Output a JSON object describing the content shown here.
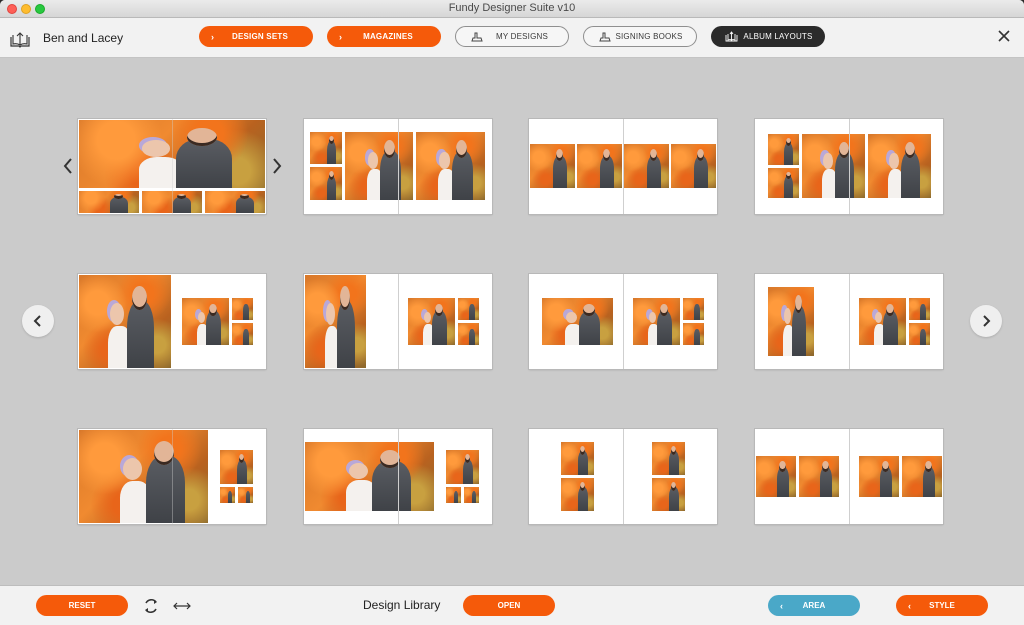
{
  "window": {
    "title": "Fundy Designer Suite v10"
  },
  "toolbar": {
    "project_name": "Ben and Lacey",
    "logo_icon": "open-book-icon",
    "nav": [
      {
        "label": "DESIGN SETS",
        "style": "orange",
        "icon": "chevron-right-icon"
      },
      {
        "label": "MAGAZINES",
        "style": "orange",
        "icon": "chevron-right-icon"
      },
      {
        "label": "MY DESIGNS",
        "style": "outline",
        "icon": "pen-hand-icon"
      },
      {
        "label": "SIGNING BOOKS",
        "style": "outline",
        "icon": "pen-hand-icon"
      },
      {
        "label": "ALBUM LAYOUTS",
        "style": "dark",
        "icon": "album-icon",
        "active": true
      }
    ],
    "close_icon": "close-icon"
  },
  "colors": {
    "accent_orange": "#f55a0a",
    "area_blue": "#4aa8c8",
    "active_dark": "#2b2b2b",
    "canvas_gray": "#cbcbcb"
  },
  "content": {
    "prev_set_icon": "chevron-left-icon",
    "next_set_icon": "chevron-right-icon",
    "page_prev_icon": "chevron-left-circle-icon",
    "page_next_icon": "chevron-right-circle-icon",
    "layouts": [
      {
        "row": 1,
        "col": 1,
        "name": "full-bleed-panorama-with-three-strip",
        "selected": true
      },
      {
        "row": 1,
        "col": 2,
        "name": "two-stacked-plus-two-large"
      },
      {
        "row": 1,
        "col": 3,
        "name": "four-across-center-band"
      },
      {
        "row": 1,
        "col": 4,
        "name": "two-stacked-plus-two-large-inset"
      },
      {
        "row": 2,
        "col": 1,
        "name": "full-left-page-plus-three-grid"
      },
      {
        "row": 2,
        "col": 2,
        "name": "partial-left-bleed-plus-three-grid"
      },
      {
        "row": 2,
        "col": 3,
        "name": "single-left-plus-three-grid"
      },
      {
        "row": 2,
        "col": 4,
        "name": "portrait-left-plus-three-grid"
      },
      {
        "row": 3,
        "col": 1,
        "name": "wide-bleed-plus-three-stack"
      },
      {
        "row": 3,
        "col": 2,
        "name": "center-panorama-plus-three-stack"
      },
      {
        "row": 3,
        "col": 3,
        "name": "two-stacked-per-page"
      },
      {
        "row": 3,
        "col": 4,
        "name": "two-pairs-center-band"
      }
    ]
  },
  "bottombar": {
    "reset_label": "RESET",
    "refresh_icon": "refresh-icon",
    "swap_icon": "horizontal-arrows-icon",
    "title": "Design Library",
    "open_label": "OPEN",
    "area_label": "AREA",
    "style_label": "STYLE"
  }
}
